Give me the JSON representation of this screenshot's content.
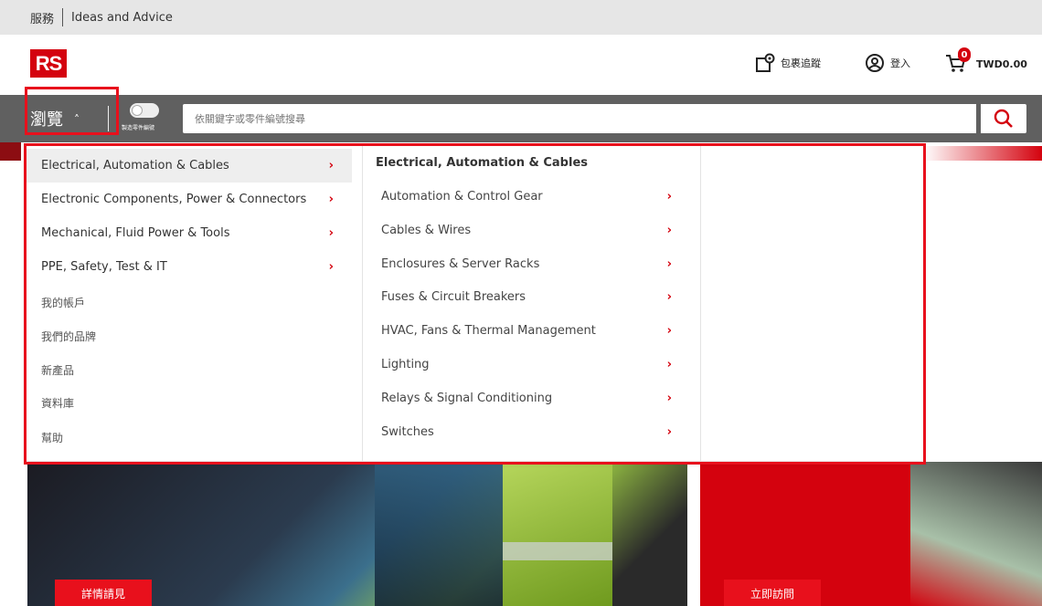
{
  "utility_bar": {
    "service": "服務",
    "ideas": "Ideas and Advice"
  },
  "header": {
    "logo": "RS",
    "track_label": "包裹追蹤",
    "login_label": "登入",
    "cart_count": "0",
    "cart_total": "TWD0.00"
  },
  "search_bar": {
    "browse_label": "瀏覽",
    "toggle_label": "製造零件編號",
    "search_placeholder": "依關鍵字或零件編號搜尋"
  },
  "dropdown": {
    "categories": [
      {
        "label": "Electrical, Automation & Cables"
      },
      {
        "label": "Electronic Components, Power & Connectors"
      },
      {
        "label": "Mechanical, Fluid Power & Tools"
      },
      {
        "label": "PPE, Safety, Test & IT"
      }
    ],
    "links": [
      {
        "label": "我的帳戶"
      },
      {
        "label": "我們的品牌"
      },
      {
        "label": "新產品"
      },
      {
        "label": "資料庫"
      },
      {
        "label": "幫助"
      }
    ],
    "sub_title": "Electrical, Automation & Cables",
    "sub_items": [
      {
        "label": "Automation & Control Gear"
      },
      {
        "label": "Cables & Wires"
      },
      {
        "label": "Enclosures & Server Racks"
      },
      {
        "label": "Fuses & Circuit Breakers"
      },
      {
        "label": "HVAC, Fans & Thermal Management"
      },
      {
        "label": "Lighting"
      },
      {
        "label": "Relays & Signal Conditioning"
      },
      {
        "label": "Switches"
      }
    ]
  },
  "hero": {
    "left_cta": "詳情請見",
    "right_cta": "立即訪問"
  },
  "colors": {
    "brand_red": "#d4020e",
    "bar_gray": "#606060"
  }
}
